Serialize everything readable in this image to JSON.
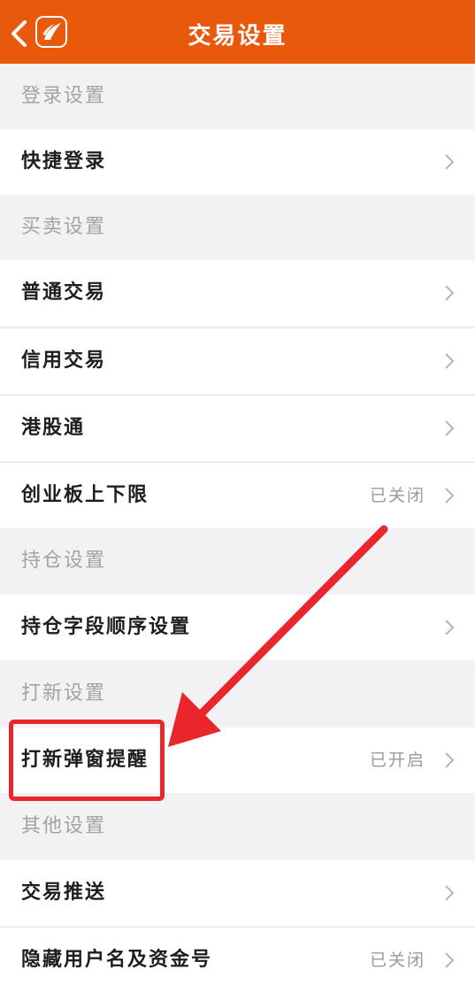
{
  "header": {
    "title": "交易设置",
    "back_icon": "chevron-left-icon",
    "logo_icon": "app-logo-icon",
    "bg_color": "#e8590c"
  },
  "sections": [
    {
      "title": "登录设置",
      "items": [
        {
          "label": "快捷登录",
          "status": ""
        }
      ]
    },
    {
      "title": "买卖设置",
      "items": [
        {
          "label": "普通交易",
          "status": ""
        },
        {
          "label": "信用交易",
          "status": ""
        },
        {
          "label": "港股通",
          "status": ""
        },
        {
          "label": "创业板上下限",
          "status": "已关闭"
        }
      ]
    },
    {
      "title": "持仓设置",
      "items": [
        {
          "label": "持仓字段顺序设置",
          "status": ""
        }
      ]
    },
    {
      "title": "打新设置",
      "items": [
        {
          "label": "打新弹窗提醒",
          "status": "已开启"
        }
      ]
    },
    {
      "title": "其他设置",
      "items": [
        {
          "label": "交易推送",
          "status": ""
        },
        {
          "label": "隐藏用户名及资金号",
          "status": "已关闭"
        }
      ]
    }
  ],
  "annotation": {
    "color": "#e8262c",
    "highlight_target": "打新弹窗提醒"
  }
}
